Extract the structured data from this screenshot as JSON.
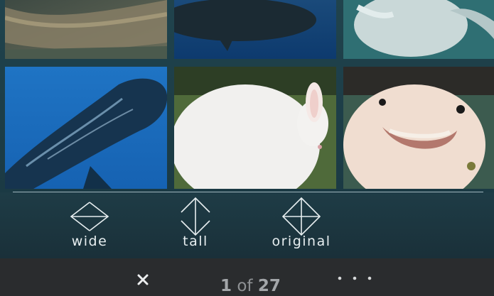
{
  "photos": [
    {
      "name": "moray-eel-photo"
    },
    {
      "name": "dark-whale-photo"
    },
    {
      "name": "beluga-photo"
    },
    {
      "name": "sperm-whale-photo"
    },
    {
      "name": "white-rabbit-photo"
    },
    {
      "name": "axolotl-photo"
    }
  ],
  "crop_options": {
    "wide": "wide",
    "tall": "tall",
    "original": "original"
  },
  "pager": {
    "current": "1",
    "separator": "of",
    "total": "27"
  },
  "icons": {
    "close": "close-icon",
    "more": "more-dots-icon",
    "wide": "arrows-horizontal-icon",
    "tall": "arrows-vertical-icon",
    "original": "arrows-diamond-icon"
  },
  "colors": {
    "crop_bar_bg": "#1d3740",
    "bottom_bar_bg": "#2a2c2e",
    "label_text": "#e7eef0",
    "counter_text": "#8d9093"
  }
}
